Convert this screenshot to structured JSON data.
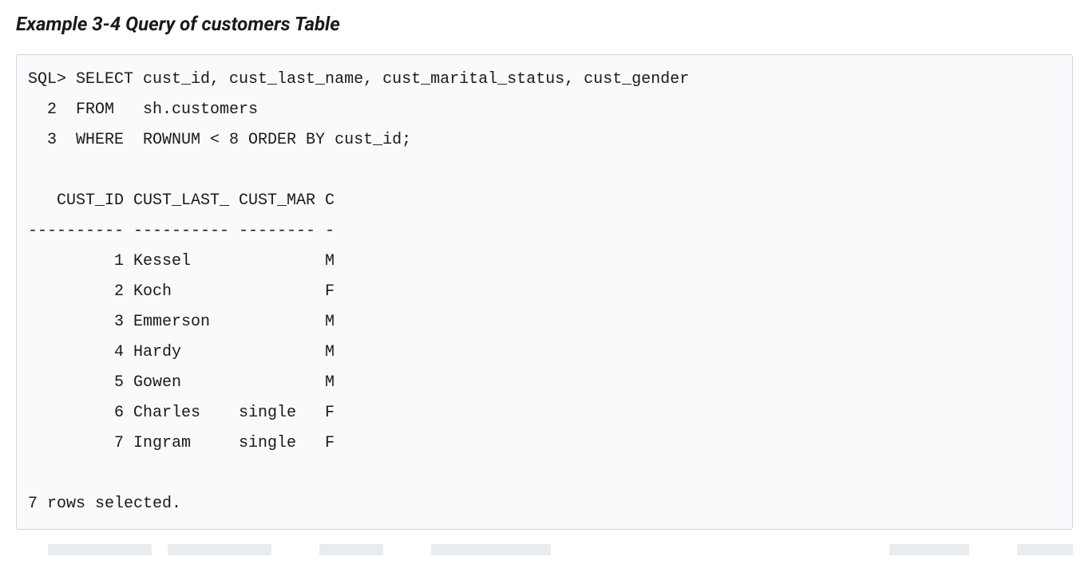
{
  "title": "Example 3-4 Query of customers Table",
  "code": {
    "line1": "SQL> SELECT cust_id, cust_last_name, cust_marital_status, cust_gender",
    "line2": "  2  FROM   sh.customers",
    "line3": "  3  WHERE  ROWNUM < 8 ORDER BY cust_id;",
    "blank1": "",
    "header": "   CUST_ID CUST_LAST_ CUST_MAR C",
    "divider": "---------- ---------- -------- -",
    "row1": "         1 Kessel              M",
    "row2": "         2 Koch                F",
    "row3": "         3 Emmerson            M",
    "row4": "         4 Hardy               M",
    "row5": "         5 Gowen               M",
    "row6": "         6 Charles    single   F",
    "row7": "         7 Ingram     single   F",
    "blank2": "",
    "footer": "7 rows selected."
  }
}
